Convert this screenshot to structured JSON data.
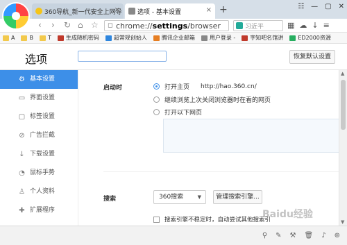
{
  "browser": {
    "tabs": [
      {
        "title": "360导航_新一代安全上网导",
        "icon_color": "#f5c518"
      },
      {
        "title": "选项 - 基本设置",
        "icon_color": "#888888"
      }
    ],
    "new_tab_symbol": "+",
    "address": {
      "prefix": "chrome://",
      "bold": "settings",
      "suffix": "/browser"
    },
    "search_placeholder": "习近平",
    "bookmarks": [
      {
        "label": "A",
        "kind": "folder"
      },
      {
        "label": "B",
        "kind": "folder"
      },
      {
        "label": "T",
        "kind": "folder"
      },
      {
        "label": "生成随机密码",
        "kind": "site",
        "color": "#c0392b"
      },
      {
        "label": "超常规创始人",
        "kind": "site",
        "color": "#2e86de"
      },
      {
        "label": "腾讯企业邮箱",
        "kind": "site",
        "color": "#e67e22"
      },
      {
        "label": "用户登录 -",
        "kind": "site",
        "color": "#888888"
      },
      {
        "label": "字知吧名馆讲",
        "kind": "site",
        "color": "#c0392b"
      },
      {
        "label": "ED2000资源",
        "kind": "site",
        "color": "#27ae60"
      }
    ]
  },
  "settings": {
    "title": "选项",
    "restore_label": "恢复默认设置",
    "sidebar": [
      {
        "label": "基本设置",
        "icon": "gear-icon",
        "glyph": "⚙",
        "active": true
      },
      {
        "label": "界面设置",
        "icon": "window-icon",
        "glyph": "▭",
        "active": false
      },
      {
        "label": "标签设置",
        "icon": "tab-icon",
        "glyph": "▢",
        "active": false
      },
      {
        "label": "广告拦截",
        "icon": "block-icon",
        "glyph": "⊘",
        "active": false
      },
      {
        "label": "下载设置",
        "icon": "download-icon",
        "glyph": "↓",
        "active": false
      },
      {
        "label": "鼠标手势",
        "icon": "mouse-icon",
        "glyph": "◔",
        "active": false
      },
      {
        "label": "个人资料",
        "icon": "person-icon",
        "glyph": "♙",
        "active": false
      },
      {
        "label": "扩展程序",
        "icon": "puzzle-icon",
        "glyph": "✚",
        "active": false
      }
    ],
    "startup": {
      "label": "启动时",
      "options": [
        {
          "label": "打开主页",
          "selected": true,
          "url": "http://hao.360.cn/"
        },
        {
          "label": "继续浏览上次关闭浏览器时在看的网页",
          "selected": false
        },
        {
          "label": "打开以下网页",
          "selected": false
        }
      ]
    },
    "search": {
      "label": "搜索",
      "engine": "360搜索",
      "manage_label": "管理搜索引擎...",
      "fallback_label": "搜索引擎不稳定时，自动尝试其他搜索引"
    }
  },
  "watermark": "Baidu经验"
}
